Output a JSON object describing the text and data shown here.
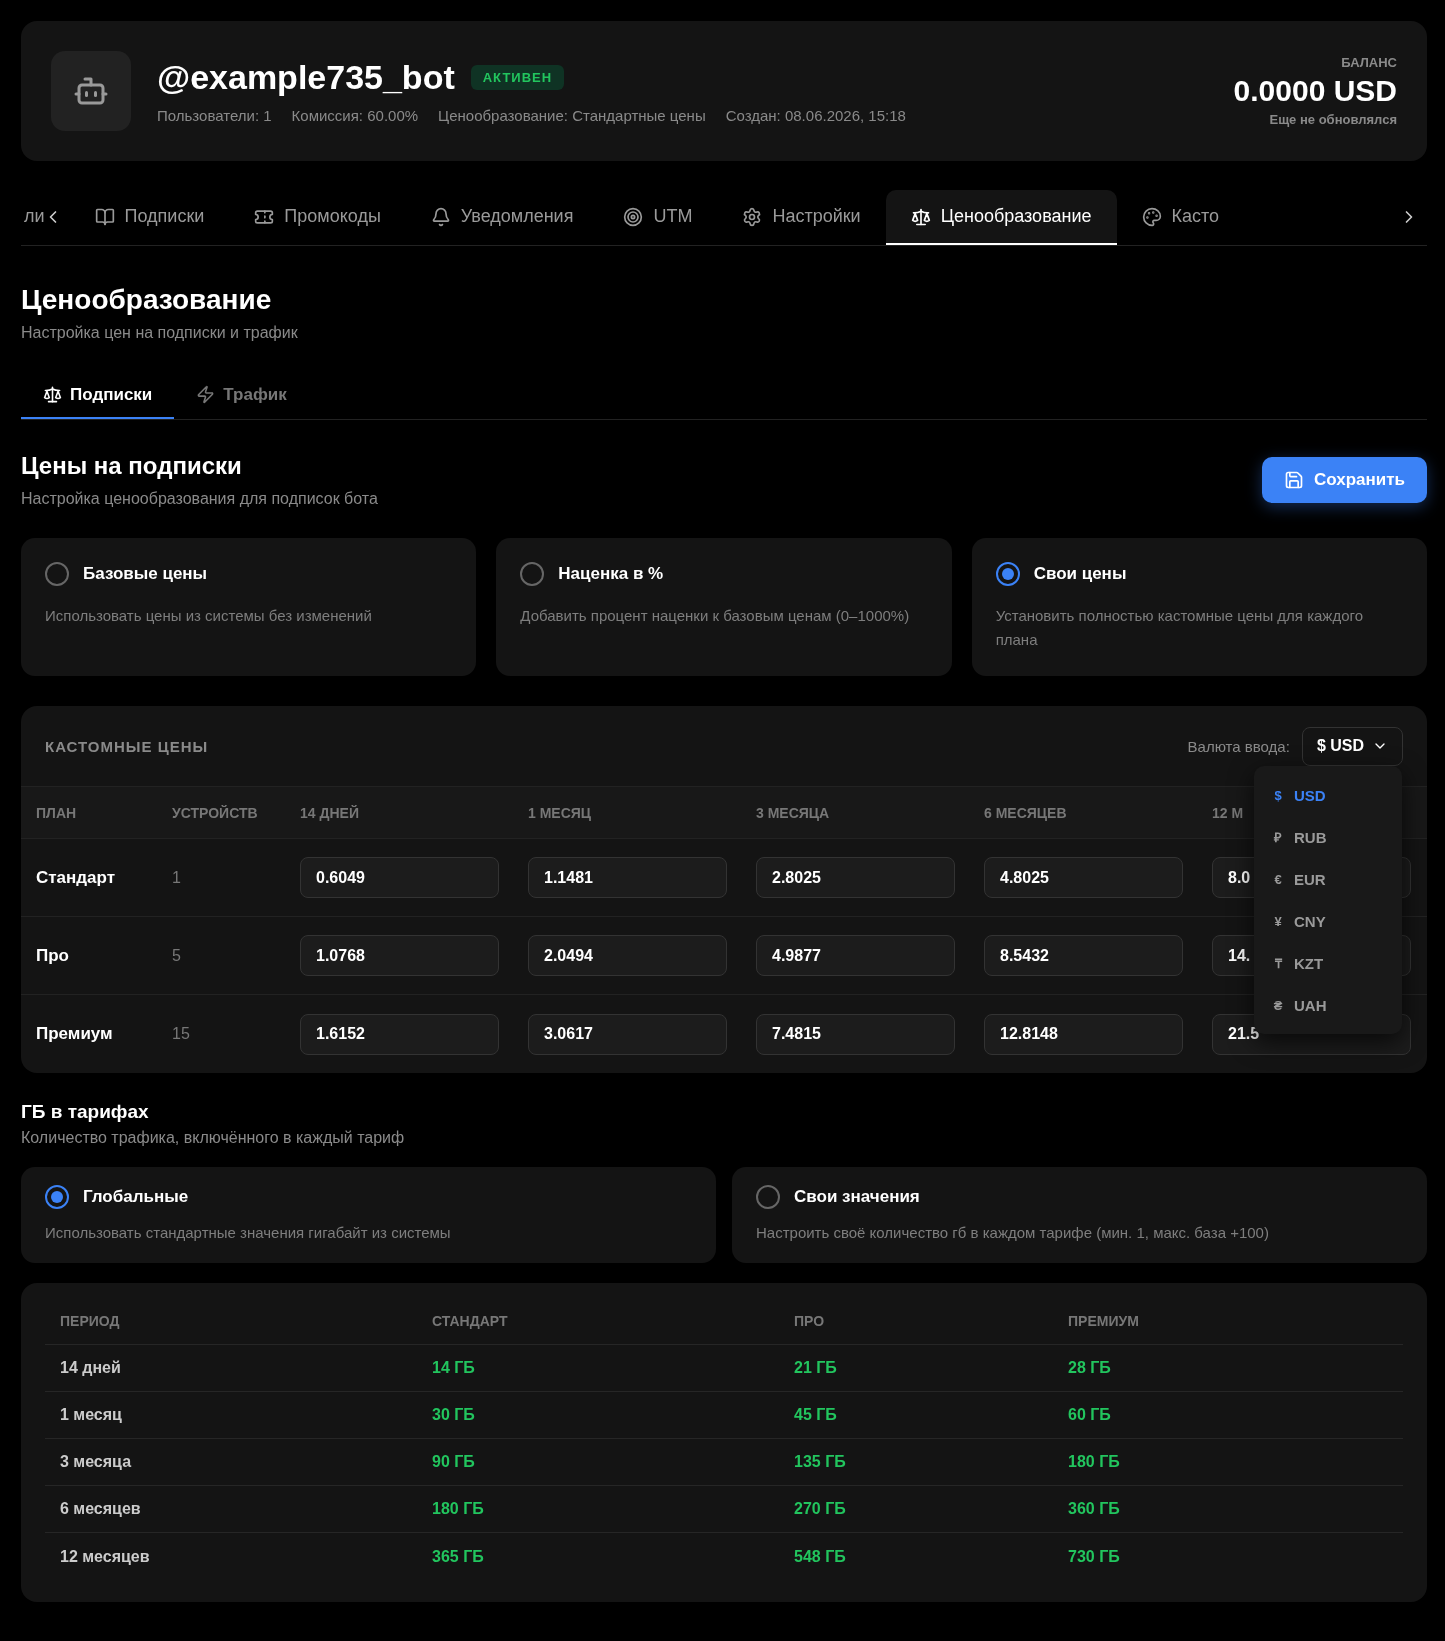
{
  "bot": {
    "name": "@example735_bot",
    "status": "АКТИВЕН",
    "meta": [
      "Пользователи: 1",
      "Комиссия: 60.00%",
      "Ценообразование: Стандартные цены",
      "Создан: 08.06.2026, 15:18"
    ],
    "balance_label": "БАЛАНС",
    "balance": "0.0000 USD",
    "balance_note": "Еще не обновлялся"
  },
  "tabs": [
    {
      "label": "ли",
      "selected": false
    },
    {
      "label": "Подписки",
      "selected": false
    },
    {
      "label": "Промокоды",
      "selected": false
    },
    {
      "label": "Уведомления",
      "selected": false
    },
    {
      "label": "UTM",
      "selected": false
    },
    {
      "label": "Настройки",
      "selected": false
    },
    {
      "label": "Ценообразование",
      "selected": true
    },
    {
      "label": "Касто",
      "selected": false
    }
  ],
  "page": {
    "title": "Ценообразование",
    "subtitle": "Настройка цен на подписки и трафик"
  },
  "subtabs": [
    {
      "label": "Подписки",
      "selected": true
    },
    {
      "label": "Трафик",
      "selected": false
    }
  ],
  "prices": {
    "title": "Цены на подписки",
    "subtitle": "Настройка ценообразования для подписок бота",
    "save": "Сохранить",
    "modes": [
      {
        "title": "Базовые цены",
        "text": "Использовать цены из системы без изменений",
        "selected": false
      },
      {
        "title": "Наценка в %",
        "text": "Добавить процент наценки к базовым ценам (0–1000%)",
        "selected": false
      },
      {
        "title": "Свои цены",
        "text": "Установить полностью кастомные цены для каждого плана",
        "selected": true
      }
    ],
    "custom": {
      "title": "КАСТОМНЫЕ ЦЕНЫ",
      "currency_label": "Валюта ввода:",
      "currency": "$ USD",
      "currency_options": [
        {
          "symbol": "$",
          "code": "USD",
          "selected": true
        },
        {
          "symbol": "₽",
          "code": "RUB",
          "selected": false
        },
        {
          "symbol": "€",
          "code": "EUR",
          "selected": false
        },
        {
          "symbol": "¥",
          "code": "CNY",
          "selected": false
        },
        {
          "symbol": "₸",
          "code": "KZT",
          "selected": false
        },
        {
          "symbol": "₴",
          "code": "UAH",
          "selected": false
        }
      ],
      "columns": [
        "ПЛАН",
        "УСТРОЙСТВ",
        "14 ДНЕЙ",
        "1 МЕСЯЦ",
        "3 МЕСЯЦА",
        "6 МЕСЯЦЕВ",
        "12 М"
      ],
      "rows": [
        {
          "plan": "Стандарт",
          "devices": "1",
          "prices": [
            "0.6049",
            "1.1481",
            "2.8025",
            "4.8025",
            "8.0"
          ]
        },
        {
          "plan": "Про",
          "devices": "5",
          "prices": [
            "1.0768",
            "2.0494",
            "4.9877",
            "8.5432",
            "14."
          ]
        },
        {
          "plan": "Премиум",
          "devices": "15",
          "prices": [
            "1.6152",
            "3.0617",
            "7.4815",
            "12.8148",
            "21.5"
          ]
        }
      ]
    }
  },
  "traffic": {
    "title": "ГБ в тарифах",
    "subtitle": "Количество трафика, включённого в каждый тариф",
    "modes": [
      {
        "title": "Глобальные",
        "text": "Использовать стандартные значения гигабайт из системы",
        "selected": true
      },
      {
        "title": "Свои значения",
        "text": "Настроить своё количество гб в каждом тарифе (мин. 1, макс. база +100)",
        "selected": false
      }
    ],
    "columns": [
      "ПЕРИОД",
      "СТАНДАРТ",
      "ПРО",
      "ПРЕМИУМ"
    ],
    "rows": [
      [
        "14 дней",
        "14 ГБ",
        "21 ГБ",
        "28 ГБ"
      ],
      [
        "1 месяц",
        "30 ГБ",
        "45 ГБ",
        "60 ГБ"
      ],
      [
        "3 месяца",
        "90 ГБ",
        "135 ГБ",
        "180 ГБ"
      ],
      [
        "6 месяцев",
        "180 ГБ",
        "270 ГБ",
        "360 ГБ"
      ],
      [
        "12 месяцев",
        "365 ГБ",
        "548 ГБ",
        "730 ГБ"
      ]
    ]
  }
}
